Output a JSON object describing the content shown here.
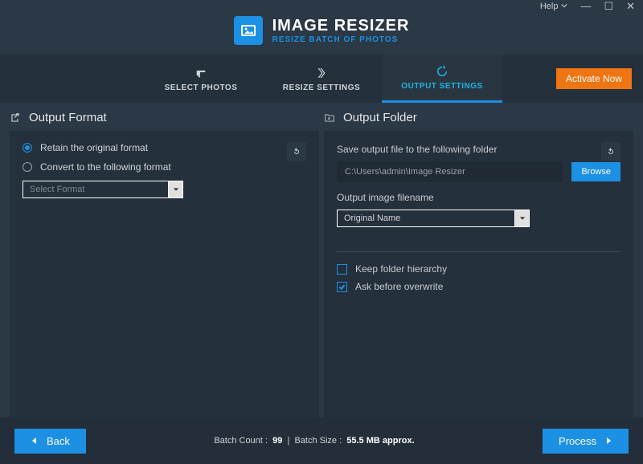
{
  "titlebar": {
    "help": "Help"
  },
  "app": {
    "title": "IMAGE RESIZER",
    "tagline": "RESIZE BATCH OF PHOTOS"
  },
  "tabs": {
    "select_photos": "SELECT PHOTOS",
    "resize_settings": "RESIZE SETTINGS",
    "output_settings": "OUTPUT SETTINGS"
  },
  "activate": "Activate Now",
  "left": {
    "heading": "Output Format",
    "retain": "Retain the original format",
    "convert": "Convert to the following format",
    "select_placeholder": "Select Format"
  },
  "right": {
    "heading": "Output Folder",
    "save_label": "Save output file to the following folder",
    "path": "C:\\Users\\admin\\Image Resizer",
    "browse": "Browse",
    "filename_label": "Output image filename",
    "filename_value": "Original Name",
    "keep_hierarchy": "Keep folder hierarchy",
    "ask_overwrite": "Ask before overwrite"
  },
  "footer": {
    "back": "Back",
    "count_label": "Batch Count :",
    "count_value": "99",
    "size_label": "Batch Size :",
    "size_value": "55.5 MB approx.",
    "process": "Process"
  }
}
